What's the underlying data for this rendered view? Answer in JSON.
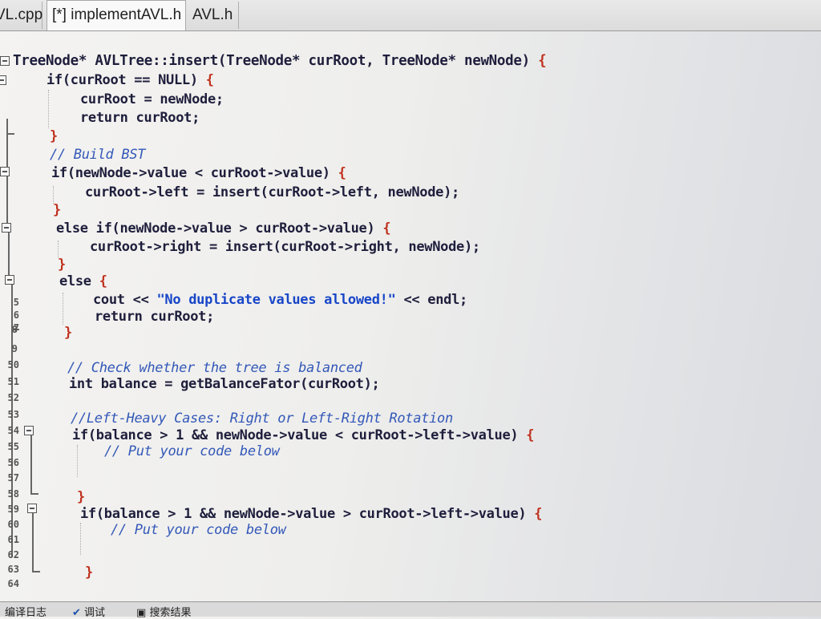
{
  "tabs": [
    {
      "label": "VL.cpp"
    },
    {
      "label": "[*] implementAVL.h"
    },
    {
      "label": "AVL.h"
    }
  ],
  "line_numbers": [
    "5",
    "6",
    "7",
    "8",
    "9",
    "50",
    "51",
    "52",
    "53",
    "54",
    "55",
    "56",
    "57",
    "58",
    "59",
    "60",
    "61",
    "62",
    "63",
    "64"
  ],
  "code": {
    "l1": [
      "TreeNode* AVLTree::insert(TreeNode* curRoot, TreeNode* newNode) ",
      "{"
    ],
    "l2": [
      "if(curRoot == NULL) ",
      "{"
    ],
    "l3": "curRoot = newNode;",
    "l4": "return curRoot;",
    "l5": "}",
    "l6": "// Build BST",
    "l7": [
      "if(newNode->value < curRoot->value) ",
      "{"
    ],
    "l8": "curRoot->left = insert(curRoot->left, newNode);",
    "l9": "}",
    "l10": [
      "else if(newNode->value > curRoot->value) ",
      "{"
    ],
    "l11": "curRoot->right = insert(curRoot->right, newNode);",
    "l12": "}",
    "l13": [
      "else ",
      "{"
    ],
    "l14": [
      "cout << ",
      "\"No duplicate values allowed!\"",
      " << endl;"
    ],
    "l15": "return curRoot;",
    "l16": "}",
    "l17": "// Check whether the tree is balanced",
    "l18": "int balance = getBalanceFator(curRoot);",
    "l19": "//Left-Heavy Cases: Right or Left-Right Rotation",
    "l20": [
      "if(balance > 1 && newNode->value < curRoot->left->value) ",
      "{"
    ],
    "l21": "// Put your code below",
    "l22": "}",
    "l23": [
      "if(balance > 1 && newNode->value > curRoot->left->value) ",
      "{"
    ],
    "l24": "// Put your code below",
    "l25": "}"
  },
  "bottom_tabs": [
    "编译日志",
    "调试",
    "搜索结果"
  ]
}
